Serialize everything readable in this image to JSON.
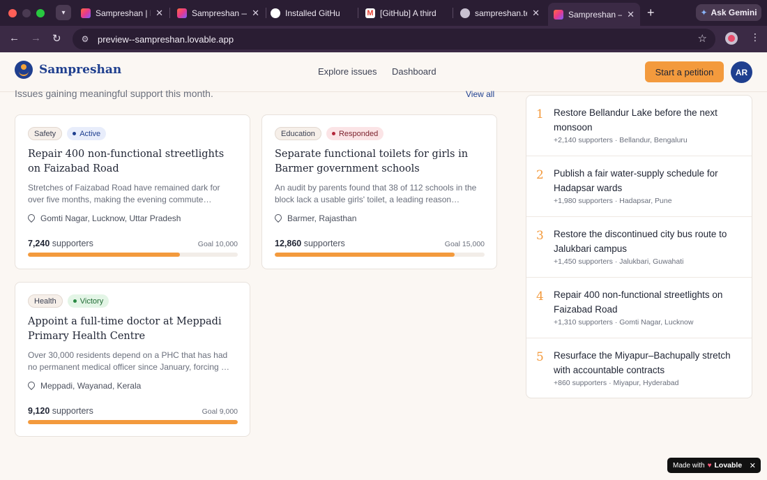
{
  "browser": {
    "tabs": [
      {
        "label": "Sampreshan | L",
        "icon": "lovable-heart-icon"
      },
      {
        "label": "Sampreshan —",
        "icon": "lovable-heart-icon"
      },
      {
        "label": "Installed GitHu",
        "icon": "github-icon"
      },
      {
        "label": "[GitHub] A third",
        "icon": "gmail-icon"
      },
      {
        "label": "sampreshan.ten",
        "icon": "globe-icon"
      },
      {
        "label": "Sampreshan —",
        "icon": "lovable-heart-icon",
        "active": true
      }
    ],
    "gemini_label": "Ask Gemini",
    "url": "preview--sampreshan.lovable.app"
  },
  "header": {
    "brand": "Sampreshan",
    "nav": [
      "Explore issues",
      "Dashboard"
    ],
    "cta": "Start a petition",
    "avatar": "AR"
  },
  "main": {
    "subtitle": "Issues gaining meaningful support this month.",
    "view_all": "View all",
    "cards": [
      {
        "category": "Safety",
        "status": "Active",
        "title": "Repair 400 non-functional streetlights on Faizabad Road",
        "description": "Stretches of Faizabad Road have remained dark for over five months, making the evening commute…",
        "location": "Gomti Nagar, Lucknow, Uttar Pradesh",
        "supporters": "7,240",
        "supporters_label": "supporters",
        "goal": "Goal 10,000",
        "progress": 0.724
      },
      {
        "category": "Education",
        "status": "Responded",
        "title": "Separate functional toilets for girls in Barmer government schools",
        "description": "An audit by parents found that 38 of 112 schools in the block lack a usable girls' toilet, a leading reason…",
        "location": "Barmer, Rajasthan",
        "supporters": "12,860",
        "supporters_label": "supporters",
        "goal": "Goal 15,000",
        "progress": 0.857
      },
      {
        "category": "Health",
        "status": "Victory",
        "title": "Appoint a full-time doctor at Meppadi Primary Health Centre",
        "description": "Over 30,000 residents depend on a PHC that has had no permanent medical officer since January, forcing …",
        "location": "Meppadi, Wayanad, Kerala",
        "supporters": "9,120",
        "supporters_label": "supporters",
        "goal": "Goal 9,000",
        "progress": 1.0
      }
    ]
  },
  "trending": [
    {
      "rank": "1",
      "title": "Restore Bellandur Lake before the next monsoon",
      "meta": "+2,140 supporters · Bellandur, Bengaluru"
    },
    {
      "rank": "2",
      "title": "Publish a fair water-supply schedule for Hadapsar wards",
      "meta": "+1,980 supporters · Hadapsar, Pune"
    },
    {
      "rank": "3",
      "title": "Restore the discontinued city bus route to Jalukbari campus",
      "meta": "+1,450 supporters · Jalukbari, Guwahati"
    },
    {
      "rank": "4",
      "title": "Repair 400 non-functional streetlights on Faizabad Road",
      "meta": "+1,310 supporters · Gomti Nagar, Lucknow"
    },
    {
      "rank": "5",
      "title": "Resurface the Miyapur–Bachupally stretch with accountable contracts",
      "meta": "+860 supporters · Miyapur, Hyderabad"
    }
  ],
  "badge": {
    "made_with": "Made with",
    "brand": "Lovable"
  },
  "colors": {
    "accent": "#f39a3d",
    "brand": "#1f3f8f"
  }
}
